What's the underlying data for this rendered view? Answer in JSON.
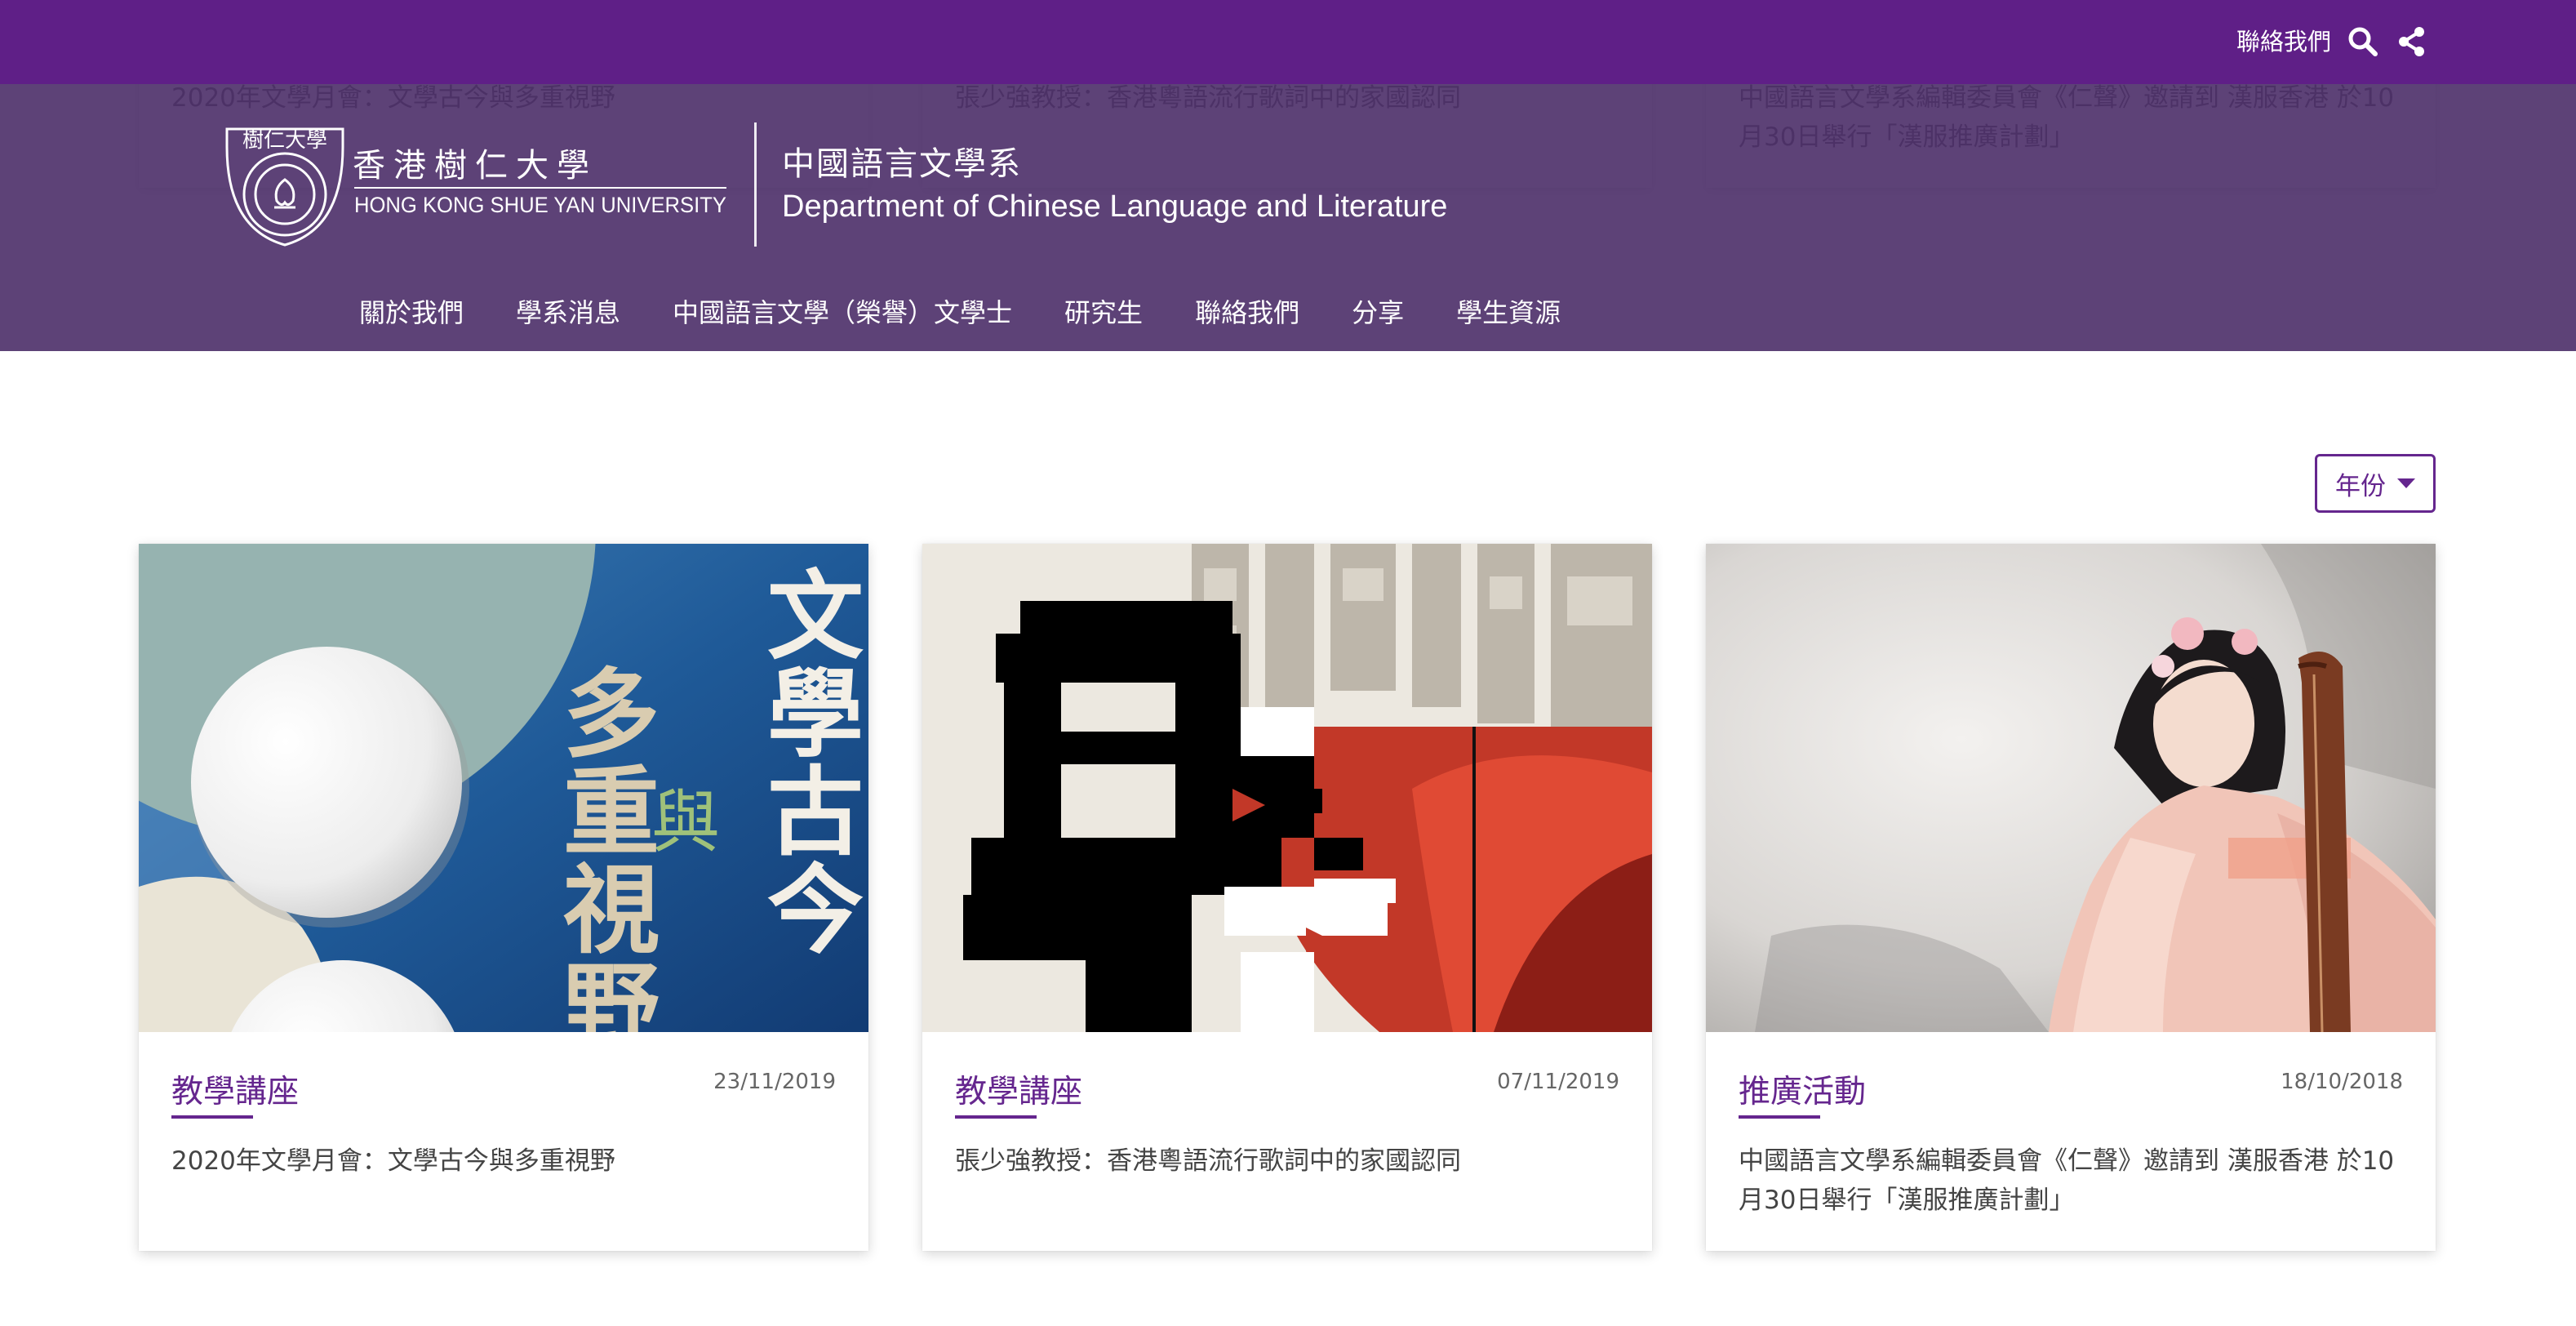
{
  "topbar": {
    "contact_label": "聯絡我們",
    "search_icon": "search-icon",
    "share_icon": "share-icon"
  },
  "brand": {
    "seal_text": "樹仁大學",
    "university_cn": "香港樹仁大學",
    "university_en": "HONG KONG SHUE YAN UNIVERSITY",
    "department_cn": "中國語言文學系",
    "department_en": "Department of Chinese Language and Literature"
  },
  "nav": [
    "關於我們",
    "學系消息",
    "中國語言文學（榮譽）文學士",
    "研究生",
    "聯絡我們",
    "分享",
    "學生資源"
  ],
  "filter": {
    "label": "年份"
  },
  "cards": [
    {
      "tag": "教學講座",
      "date": "23/11/2019",
      "title": "2020年文學月會：文學古今與多重視野",
      "image_text": {
        "col1": "文學古今",
        "mid": "與",
        "col2": "多重視野"
      }
    },
    {
      "tag": "教學講座",
      "date": "07/11/2019",
      "title": "張少強教授：香港粵語流行歌詞中的家國認同",
      "image_text": {
        "glyph": "粵"
      }
    },
    {
      "tag": "推廣活動",
      "date": "18/10/2018",
      "title": "中國語言文學系編輯委員會《仁聲》邀請到 漢服香港 於10月30日舉行「漢服推廣計劃」"
    }
  ],
  "colors": {
    "brand_purple": "#65268e",
    "topbar": "#5f1f87",
    "header_overlay": "#4d2f69"
  }
}
